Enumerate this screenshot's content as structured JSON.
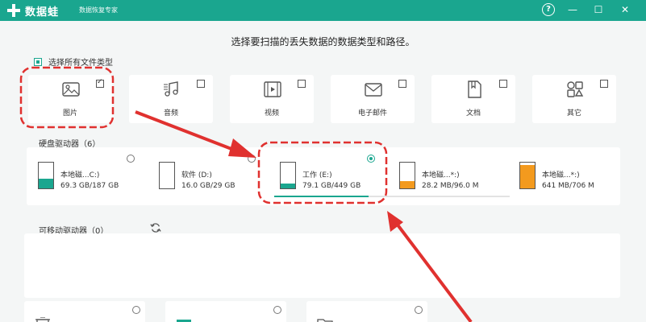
{
  "app": {
    "name": "数据蛙",
    "subtitle": "数据恢复专家",
    "help_glyph": "?",
    "minimize_glyph": "—",
    "maximize_glyph": "☐",
    "close_glyph": "✕"
  },
  "prompt": "选择要扫描的丢失数据的数据类型和路径。",
  "select_all_label": "选择所有文件类型",
  "file_types": [
    {
      "label": "图片",
      "icon": "image-icon",
      "checked": true
    },
    {
      "label": "音频",
      "icon": "audio-icon",
      "checked": false
    },
    {
      "label": "视频",
      "icon": "video-icon",
      "checked": false
    },
    {
      "label": "电子邮件",
      "icon": "email-icon",
      "checked": false
    },
    {
      "label": "文档",
      "icon": "document-icon",
      "checked": false
    },
    {
      "label": "其它",
      "icon": "other-icon",
      "checked": false
    }
  ],
  "hard_drives": {
    "title": "硬盘驱动器（6）",
    "drives": [
      {
        "name": "本地磁...C:)",
        "size": "69.3 GB/187 GB",
        "selected": false,
        "used_fraction": 0.37,
        "color": "#1aa68f"
      },
      {
        "name": "软件 (D:)",
        "size": "16.0 GB/29 GB",
        "selected": false,
        "used_fraction": 0.0,
        "color": "#1aa68f"
      },
      {
        "name": "工作 (E:)",
        "size": "79.1 GB/449 GB",
        "selected": true,
        "used_fraction": 0.18,
        "color": "#1aa68f"
      },
      {
        "name": "本地磁...*:)",
        "size": "28.2 MB/96.0 M",
        "selected": false,
        "used_fraction": 0.29,
        "color": "#f39a1e"
      },
      {
        "name": "本地磁...*:)",
        "size": "641 MB/706 M",
        "selected": false,
        "used_fraction": 0.91,
        "color": "#f39a1e"
      }
    ]
  },
  "removable": {
    "title": "可移动驱动器（0）",
    "refresh_icon": "refresh-icon"
  },
  "colors": {
    "accent": "#1aa68f",
    "annotation": "#e0312f"
  }
}
